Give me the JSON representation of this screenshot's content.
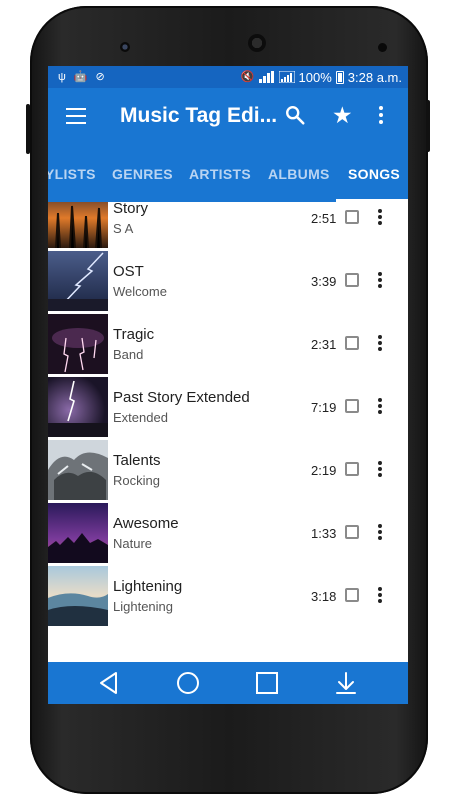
{
  "status_bar": {
    "left_icons": [
      "usb-icon",
      "android-icon",
      "signal-off-icon"
    ],
    "right_icons": [
      "mute-icon",
      "signal-icon",
      "signal-icon",
      "battery-icon"
    ],
    "battery": "100%",
    "time": "3:28 a.m."
  },
  "app_bar": {
    "title": "Music Tag Edi...",
    "icons": [
      "menu-icon",
      "search-icon",
      "star-icon",
      "more-vert-icon"
    ]
  },
  "tabs": [
    {
      "label": "YLISTS",
      "active": false
    },
    {
      "label": "GENRES",
      "active": false
    },
    {
      "label": "ARTISTS",
      "active": false
    },
    {
      "label": "ALBUMS",
      "active": false
    },
    {
      "label": "SONGS",
      "active": true
    }
  ],
  "songs": [
    {
      "title": "Story",
      "artist": "S A",
      "duration": "2:51",
      "checked": false,
      "thumb": "sunset-trees"
    },
    {
      "title": "OST",
      "artist": "Welcome",
      "duration": "3:39",
      "checked": false,
      "thumb": "lightning-blue"
    },
    {
      "title": "Tragic",
      "artist": "Band",
      "duration": "2:31",
      "checked": false,
      "thumb": "lightning-pink"
    },
    {
      "title": "Past Story Extended",
      "artist": "Extended",
      "duration": "7:19",
      "checked": false,
      "thumb": "lightning-purple"
    },
    {
      "title": "Talents",
      "artist": "Rocking",
      "duration": "2:19",
      "checked": false,
      "thumb": "rocks"
    },
    {
      "title": "Awesome",
      "artist": "Nature",
      "duration": "1:33",
      "checked": false,
      "thumb": "purple-night"
    },
    {
      "title": "Lightening",
      "artist": "Lightening",
      "duration": "3:18",
      "checked": false,
      "thumb": "dunes"
    }
  ],
  "nav_bar": {
    "icons": [
      "back-icon",
      "home-icon",
      "recents-icon",
      "download-icon"
    ]
  },
  "colors": {
    "status_bar": "#1565c0",
    "primary": "#1976d2",
    "tab_inactive": "#b9d4f2",
    "device": "#1b1b1b"
  }
}
